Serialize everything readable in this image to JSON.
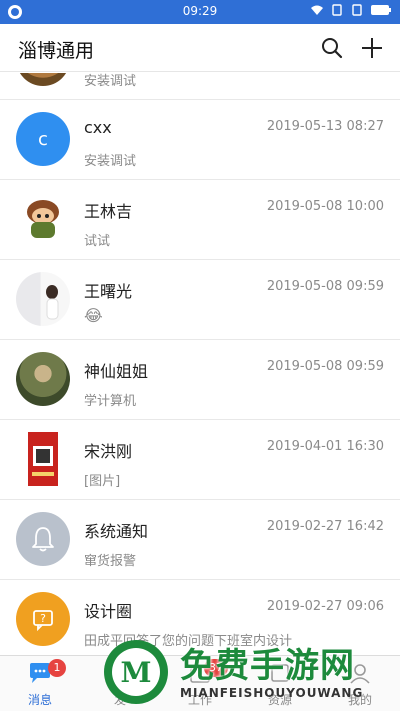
{
  "status_bar": {
    "time": "09:29"
  },
  "header": {
    "title": "淄博通用"
  },
  "conversations": [
    {
      "name": "",
      "time": "",
      "preview": "安装调试"
    },
    {
      "name": "cxx",
      "time": "2019-05-13 08:27",
      "preview": "安装调试",
      "avatar_letter": "c"
    },
    {
      "name": "王林吉",
      "time": "2019-05-08 10:00",
      "preview": "试试"
    },
    {
      "name": "王曙光",
      "time": "2019-05-08 09:59",
      "preview": "😂"
    },
    {
      "name": "神仙姐姐",
      "time": "2019-05-08 09:59",
      "preview": "学计算机"
    },
    {
      "name": "宋洪刚",
      "time": "2019-04-01 16:30",
      "preview": "[图片]"
    },
    {
      "name": "系统通知",
      "time": "2019-02-27 16:42",
      "preview": "窜货报警"
    },
    {
      "name": "设计圈",
      "time": "2019-02-27 09:06",
      "preview": "田成平回答了您的问题下班室内设计"
    }
  ],
  "tabs": [
    {
      "label": "消息",
      "badge": "1",
      "icon": "chat-icon"
    },
    {
      "label": "发",
      "badge": "",
      "icon": "compose-icon"
    },
    {
      "label": "工作",
      "badge": "37",
      "icon": "work-icon"
    },
    {
      "label": "资源",
      "badge": "",
      "icon": "resource-icon"
    },
    {
      "label": "我的",
      "badge": "",
      "icon": "profile-icon"
    }
  ],
  "watermark": {
    "title": "免费手游网",
    "subtitle": "MIANFEISHOUYOUWANG"
  },
  "colors": {
    "accent": "#2f6fd6",
    "badge": "#e64340",
    "bell_avatar": "#b9c1cc",
    "design_avatar": "#f0a020"
  }
}
